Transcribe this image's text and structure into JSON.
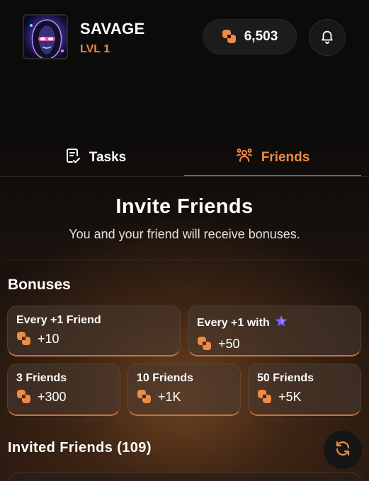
{
  "header": {
    "username": "SAVAGE",
    "level": "LVL 1",
    "balance": "6,503",
    "avatar_icon": "hooded-avatar",
    "coin_icon": "coin-icon",
    "bell_icon": "bell-icon"
  },
  "tabs": [
    {
      "label": "Tasks",
      "icon": "clipboard-check-icon",
      "active": false
    },
    {
      "label": "Friends",
      "icon": "users-icon",
      "active": true
    }
  ],
  "invite": {
    "title": "Invite Friends",
    "subtitle": "You and your friend will receive bonuses."
  },
  "bonuses": {
    "title": "Bonuses",
    "cards": [
      {
        "label": "Every +1 Friend",
        "reward": "+10"
      },
      {
        "label": "Every +1 with",
        "label_icon": "purple-star-icon",
        "reward": "+50"
      },
      {
        "label": "3 Friends",
        "reward": "+300"
      },
      {
        "label": "10 Friends",
        "reward": "+1K"
      },
      {
        "label": "50 Friends",
        "reward": "+5K"
      }
    ]
  },
  "invited": {
    "title": "Invited Friends (109)",
    "refresh_icon": "refresh-icon"
  },
  "colors": {
    "accent": "#f08a45",
    "card_border": "#c9733b",
    "star": "#7b5cff"
  }
}
